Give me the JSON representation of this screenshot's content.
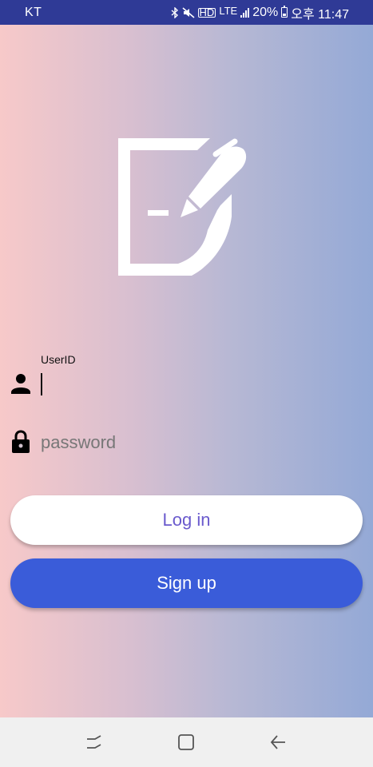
{
  "status_bar": {
    "carrier": "KT",
    "lte": "LTE",
    "battery": "20%",
    "time": "오후 11:47",
    "icons": [
      "bluetooth-icon",
      "mute-icon",
      "hd-voice-icon",
      "lte-icon",
      "signal-icon",
      "battery-icon"
    ]
  },
  "logo": {
    "icon": "note-pen-icon"
  },
  "form": {
    "userid_label": "UserID",
    "userid_value": "",
    "password_placeholder": "password",
    "password_value": ""
  },
  "buttons": {
    "login_label": "Log in",
    "signup_label": "Sign up"
  },
  "colors": {
    "status_bar": "#2f3a96",
    "gradient_left": "#f7c9c9",
    "gradient_right": "#94a9d6",
    "login_text": "#6a5acd",
    "signup_bg": "#3a5cd9"
  },
  "nav_bar": {
    "icons": [
      "recent-apps-icon",
      "home-icon",
      "back-icon"
    ]
  }
}
